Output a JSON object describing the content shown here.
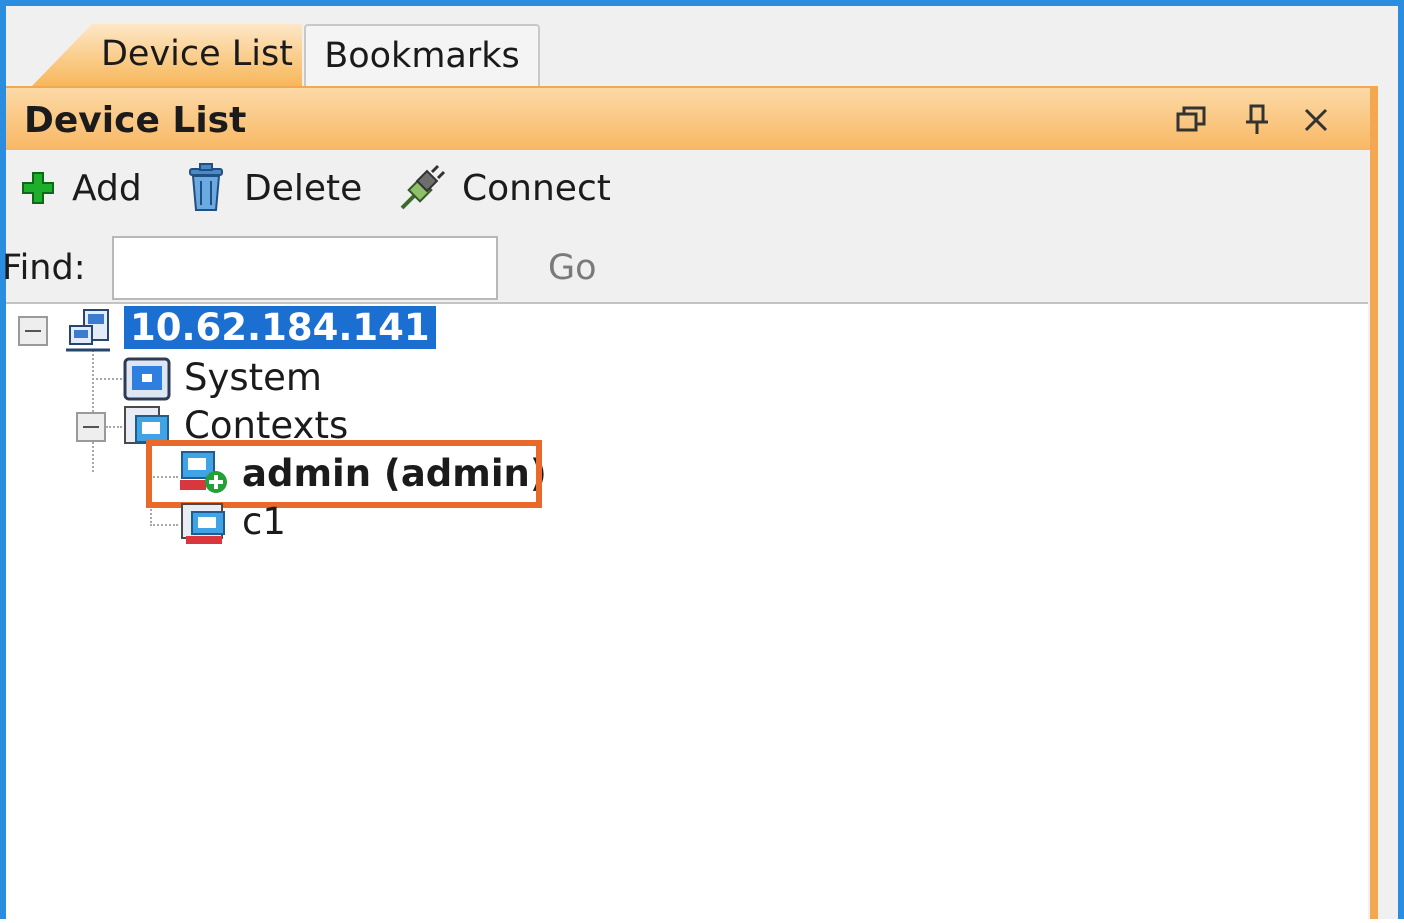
{
  "tabs": [
    {
      "label": "Device List",
      "active": true
    },
    {
      "label": "Bookmarks",
      "active": false
    }
  ],
  "panel": {
    "title": "Device List",
    "title_buttons": [
      "restore-icon",
      "pin-icon",
      "close-icon"
    ]
  },
  "toolbar": {
    "add_label": "Add",
    "delete_label": "Delete",
    "connect_label": "Connect"
  },
  "find": {
    "label": "Find:",
    "value": "",
    "go_label": "Go"
  },
  "tree": {
    "root": {
      "label": "10.62.184.141",
      "selected": true,
      "expanded": true
    },
    "system": {
      "label": "System"
    },
    "contexts": {
      "label": "Contexts",
      "expanded": true
    },
    "admin": {
      "label": "admin (admin)",
      "bold": true,
      "highlighted": true
    },
    "c1": {
      "label": "c1"
    }
  },
  "colors": {
    "accent_orange": "#f3a750",
    "highlight_box": "#e8692a",
    "selection_blue": "#1b6fd1",
    "window_border": "#2b8de0"
  }
}
